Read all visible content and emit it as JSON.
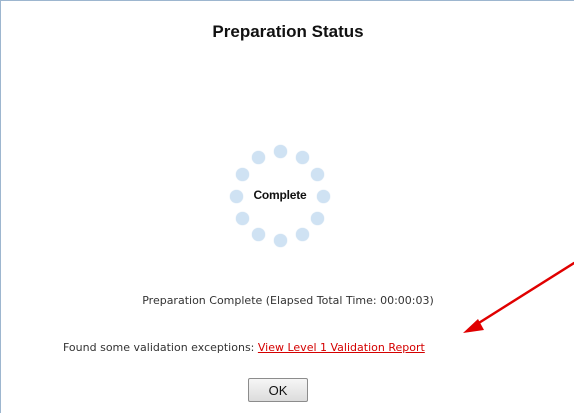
{
  "dialog": {
    "title": "Preparation Status",
    "spinner_label": "Complete",
    "elapsed_text": "Preparation Complete (Elapsed Total Time: 00:00:03)",
    "exceptions_text": "Found some validation exceptions: ",
    "report_link_label": "View Level 1 Validation Report",
    "ok_label": "OK"
  },
  "colors": {
    "link": "#d40000",
    "annotation_arrow": "#e00000",
    "spinner_dot": "#cfe2f3"
  }
}
